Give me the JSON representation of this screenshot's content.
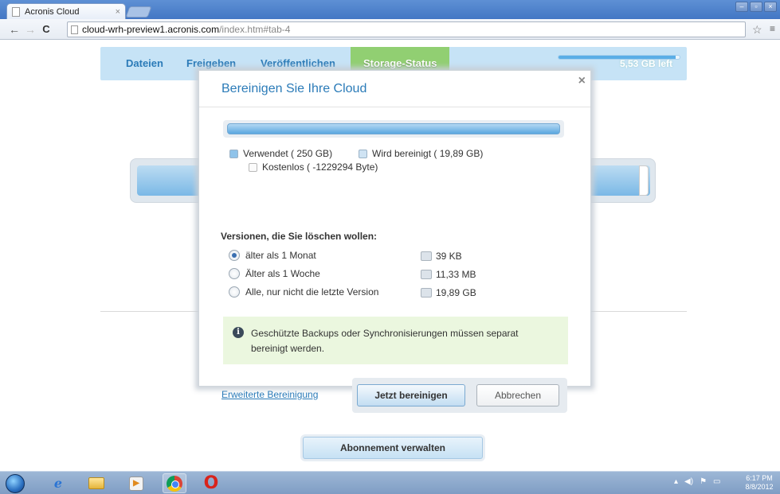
{
  "browser": {
    "tab_title": "Acronis Cloud",
    "tab_close": "×",
    "url_host": "cloud-wrh-preview1.acronis.com",
    "url_path": "/index.htm#tab-4",
    "back_glyph": "←",
    "forward_glyph": "→",
    "reload_glyph": "C",
    "star_glyph": "☆",
    "menu_glyph": "≡",
    "window_controls": [
      "–",
      "▫",
      "×"
    ]
  },
  "nav": {
    "tabs": [
      {
        "label": "Dateien"
      },
      {
        "label": "Freigeben"
      },
      {
        "label": "Veröffentlichen"
      },
      {
        "label": "Storage-Status",
        "active": true
      }
    ],
    "quota_fraction": 0.97,
    "quota_text": "5,53 GB left"
  },
  "modal": {
    "title": "Bereinigen Sie Ihre Cloud",
    "close_glyph": "×",
    "legend": {
      "used": "Verwendet ( 250 GB)",
      "cleaning": "Wird bereinigt ( 19,89 GB)",
      "free": "Kostenlos ( -1229294 Byte)"
    },
    "versions_heading": "Versionen, die Sie löschen wollen:",
    "options": [
      {
        "label": "älter als 1 Monat",
        "size": "39 KB",
        "selected": true
      },
      {
        "label": "Älter als 1 Woche",
        "size": "11,33 MB",
        "selected": false
      },
      {
        "label": "Alle, nur nicht die letzte Version",
        "size": "19,89 GB",
        "selected": false
      }
    ],
    "info_icon_glyph": "i",
    "info_text": "Geschützte Backups oder Synchronisierungen müssen separat bereinigt werden.",
    "advanced_link": "Erweiterte Bereinigung",
    "primary_button": "Jetzt bereinigen",
    "cancel_button": "Abbrechen"
  },
  "page": {
    "subscription_button": "Abonnement verwalten"
  },
  "taskbar": {
    "ie_glyph": "e",
    "media_glyph": "▶",
    "opera_glyph": "O",
    "tray_glyphs": [
      "▴",
      "◀)",
      "⚑",
      "▭"
    ],
    "clock_time": "6:17 PM",
    "clock_date": "8/8/2012"
  },
  "colors": {
    "accent_blue": "#2b7bb8",
    "nav_bg": "#c6e3f6",
    "active_tab": "#91cf72",
    "info_bg": "#ebf7df"
  }
}
